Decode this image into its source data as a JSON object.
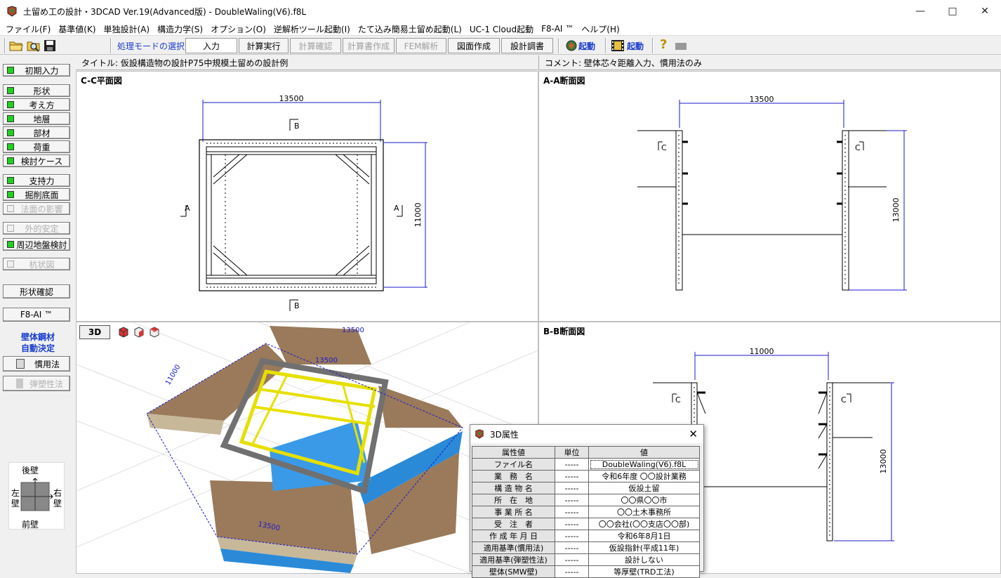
{
  "window": {
    "title": "土留め工の設計・3DCAD Ver.19(Advanced版) - DoubleWaling(V6).f8L"
  },
  "menu": [
    "ファイル(F)",
    "基準値(K)",
    "単独設計(A)",
    "構造力学(S)",
    "オプション(O)",
    "逆解析ツール起動(I)",
    "たて込み簡易土留め起動(L)",
    "UC-1 Cloud起動",
    "F8-AI ™",
    "ヘルプ(H)"
  ],
  "toolbar": {
    "mode_label": "処理モードの選択",
    "buttons": [
      "入力",
      "計算実行",
      "計算確認",
      "計算書作成",
      "FEM解析",
      "図面作成",
      "設計調書"
    ],
    "launch1": "起動",
    "launch2": "起動"
  },
  "sidebar": {
    "initial": "初期入力",
    "items1": [
      "形状",
      "考え方",
      "地層",
      "部材",
      "荷重",
      "検討ケース"
    ],
    "items2": [
      "支持力",
      "掘削底面",
      "法面の影響"
    ],
    "items3": [
      "外的安定",
      "周辺地盤検討"
    ],
    "items4": [
      "杭状図"
    ],
    "shape_check": "形状確認",
    "f8ai": "F8-AI ™",
    "auto_title": "壁体鋼材",
    "auto_sub": "自動決定",
    "kanyo": "慣用法",
    "dansosei": "弾塑性法",
    "compass": {
      "rear": "後壁",
      "front": "前壁",
      "left1": "左",
      "left2": "壁",
      "right1": "右",
      "right2": "壁"
    }
  },
  "header": {
    "title": "タイトル: 仮設構造物の設計P75中規模土留めの設計例",
    "comment": "コメント: 壁体芯々距離入力、慣用法のみ"
  },
  "panes": {
    "plan": {
      "label": "C-C平面図",
      "dim_top": "13500",
      "dim_right": "11000",
      "marker_b": "B",
      "marker_a": "A"
    },
    "aa": {
      "label": "A-A断面図",
      "dim_top": "13500",
      "dim_right": "13000",
      "marker_c": "C"
    },
    "bb": {
      "label": "B-B断面図",
      "dim_top": "11000",
      "dim_right": "13000",
      "marker_c": "C"
    },
    "view3d": {
      "button": "3D",
      "dim_a": "13500",
      "dim_b": "11000",
      "dim_c": "13500"
    }
  },
  "dialog": {
    "title": "3D属性",
    "headers": [
      "属性値",
      "単位",
      "値"
    ],
    "rows": [
      [
        "ファイル名",
        "-----",
        "DoubleWaling(V6).f8L"
      ],
      [
        "業　務　名",
        "-----",
        "令和6年度 〇〇設計業務"
      ],
      [
        "構 造 物 名",
        "-----",
        "仮設土留"
      ],
      [
        "所　在　地",
        "-----",
        "〇〇県〇〇市"
      ],
      [
        "事 業 所 名",
        "-----",
        "〇〇土木事務所"
      ],
      [
        "受　注　者",
        "-----",
        "〇〇会社(〇〇支店〇〇部)"
      ],
      [
        "作 成 年 月 日",
        "-----",
        "令和6年8月1日"
      ],
      [
        "適用基準(慣用法)",
        "-----",
        "仮設指針(平成11年)"
      ],
      [
        "適用基準(弾塑性法)",
        "-----",
        "設計しない"
      ],
      [
        "壁体(SMW壁)",
        "-----",
        "等厚壁(TRD工法)"
      ]
    ]
  },
  "colors": {
    "accent_blue": "#1a3ccc",
    "led_green": "#1fd21f",
    "dim_blue": "#1a1acc"
  }
}
